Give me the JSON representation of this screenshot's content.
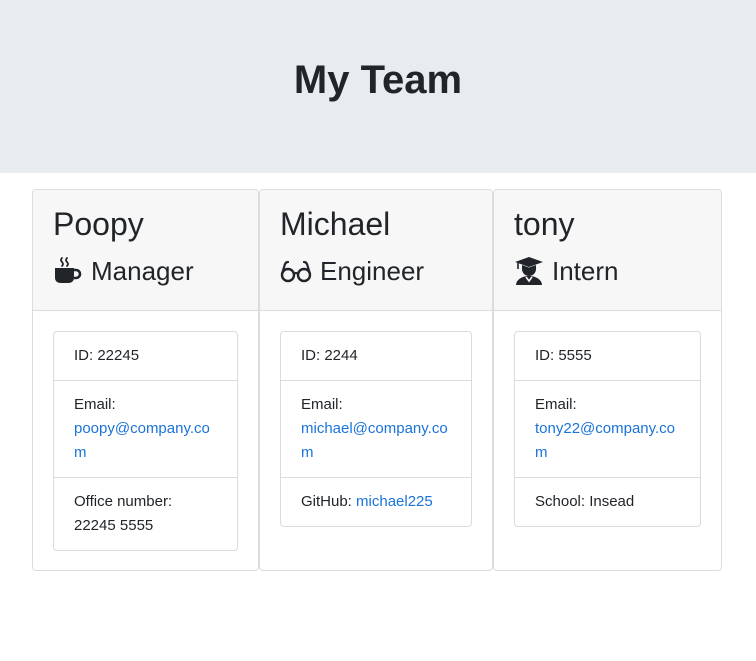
{
  "header": {
    "title": "My Team"
  },
  "employees": [
    {
      "name": "Poopy",
      "role": "Manager",
      "icon": "coffee-icon",
      "id_text": "ID: 22245",
      "email_label": "Email:",
      "email": "poopy@company.com",
      "extra_label": "Office number:",
      "extra_value": "22245 5555"
    },
    {
      "name": "Michael",
      "role": "Engineer",
      "icon": "glasses-icon",
      "id_text": "ID: 2244",
      "email_label": "Email:",
      "email": "michael@company.com",
      "extra_label": "GitHub: ",
      "extra_value": "michael225"
    },
    {
      "name": "tony",
      "role": "Intern",
      "icon": "graduate-icon",
      "id_text": "ID: 5555",
      "email_label": "Email:",
      "email": "tony22@company.com",
      "extra_label": "School: ",
      "extra_value": "Insead"
    }
  ],
  "colors": {
    "link": "#1a73d9",
    "jumbotron": "#e9ecef",
    "card_header": "#f7f7f7"
  }
}
